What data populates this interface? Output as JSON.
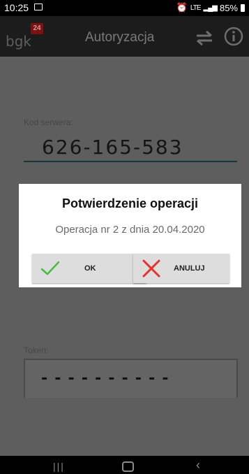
{
  "status_bar": {
    "time": "10:25",
    "network": "LTE",
    "battery": "85%"
  },
  "toolbar": {
    "logo_text": "bgk",
    "logo_badge": "24",
    "title": "Autoryzacja",
    "swap_icon": "swap-arrows-icon",
    "info_icon": "info-icon"
  },
  "form": {
    "server_label": "Kod serwera:",
    "server_code": "626-165-583",
    "token_label": "Token:",
    "token_value": "----------"
  },
  "dialog": {
    "title": "Potwierdzenie operacji",
    "message": "Operacja nr 2 z dnia 20.04.2020",
    "ok_label": "OK",
    "cancel_label": "ANULUJ"
  },
  "colors": {
    "ok_check": "#4cb848",
    "cancel_x": "#e5322d",
    "toolbar_bg": "#1c1c1c",
    "logo_badge": "#7c1111"
  },
  "nav_bar": {
    "recents_icon": "recents-icon",
    "home_icon": "home-icon",
    "back_icon": "back-icon"
  }
}
